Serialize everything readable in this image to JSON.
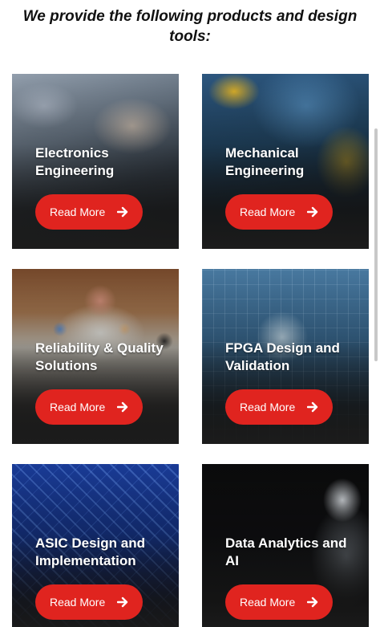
{
  "heading": "We provide the following products and design tools:",
  "cards": [
    {
      "title": "Electronics Engineering",
      "button": "Read More"
    },
    {
      "title": "Mechanical Engineering",
      "button": "Read More"
    },
    {
      "title": "Reliability & Quality Solutions",
      "button": "Read More"
    },
    {
      "title": "FPGA Design and Validation",
      "button": "Read More"
    },
    {
      "title": "ASIC Design and Implementation",
      "button": "Read More"
    },
    {
      "title": "Data Analytics and AI",
      "button": "Read More"
    }
  ],
  "icons": {
    "button_icon": "arrow-right-icon"
  },
  "colors": {
    "button": "#e0241f",
    "heading": "#111111",
    "card_title": "#ffffff"
  }
}
